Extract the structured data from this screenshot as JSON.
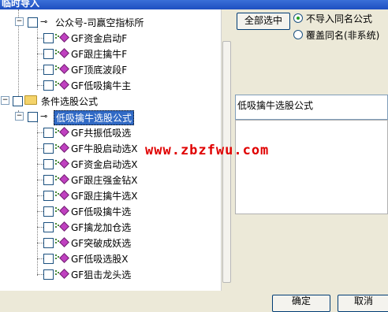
{
  "window": {
    "title": "临时导入"
  },
  "tree": {
    "group1": {
      "label": "公众号-司赢空指标所",
      "items": [
        "GF资金启动F",
        "GF跟庄擒牛F",
        "GF顶底波段F",
        "GF低吸擒牛主"
      ]
    },
    "group2": {
      "label": "条件选股公式",
      "sub_label": "低吸擒牛选股公式",
      "items": [
        "GF共振低吸选",
        "GF牛股启动选X",
        "GF资金启动选X",
        "GF跟庄强金钻X",
        "GF跟庄擒牛选X",
        "GF低吸擒牛选",
        "GF擒龙加仓选",
        "GF突破成妖选",
        "GF低吸选股X",
        "GF狙击龙头选"
      ]
    }
  },
  "right": {
    "select_all_label": "全部选中",
    "option_no_import": "不导入同名公式",
    "option_overwrite": "覆盖同名(非系统)",
    "description_title": "低吸擒牛选股公式"
  },
  "watermark": "www.zbzfwu.com",
  "footer": {
    "ok_label": "确定",
    "cancel_label": "取消"
  }
}
